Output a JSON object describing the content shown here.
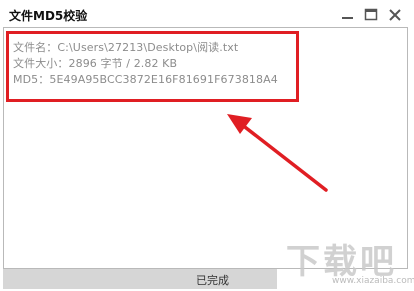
{
  "window": {
    "title": "文件MD5校验",
    "controls": {
      "minimize": "minimize-icon",
      "maximize": "maximize-icon",
      "close": "close-icon"
    }
  },
  "info": {
    "filename_line": "文件名：C:\\Users\\27213\\Desktop\\阅读.txt",
    "size_line": "文件大小：2896 字节 /  2.82 KB",
    "md5_line": "MD5：5E49A95BCC3872E16F81691F673818A4"
  },
  "status": {
    "text": "已完成"
  },
  "watermark": {
    "main": "下载吧",
    "sub": "www.xiazaiba.com"
  },
  "colors": {
    "highlight": "#e01e23",
    "text": "#8c8c8c",
    "statusbar": "#d6d6d6"
  }
}
